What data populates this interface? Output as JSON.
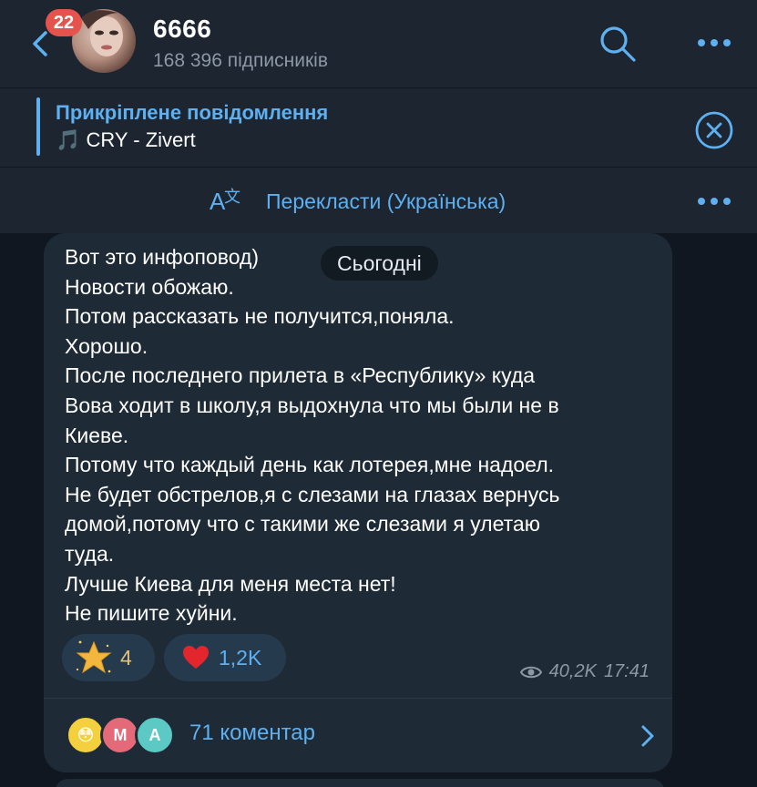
{
  "header": {
    "unread_badge": "22",
    "channel_title": "6666",
    "subscribers": "168 396 підписників",
    "icons": [
      "back-chevron-icon",
      "search-icon",
      "more-icon"
    ]
  },
  "pinned": {
    "label": "Прикріплене повідомлення",
    "text": "🎵 CRY - Zivert",
    "close_icon": "close-circle-icon"
  },
  "translate": {
    "label": "Перекласти (Українська)",
    "icon": "translate-icon"
  },
  "message": {
    "date_pill": "Сьогодні",
    "lines": [
      "Вот это инфоповод)",
      "Новости обожаю.",
      "Потом рассказать не получится,поняла.",
      "Хорошо.",
      "После последнего прилета в «Республику» куда",
      "Вова ходит в школу,я выдохнула что мы были не в",
      "Киеве.",
      "Потому что каждый день как лотерея,мне надоел.",
      "Не будет обстрелов,я с слезами на глазах вернусь",
      "домой,потому что с такими же слезами я улетаю",
      "туда.",
      "Лучше Киева для меня места нет!",
      "Не пишите хуйни."
    ],
    "reactions": [
      {
        "emoji": "⭐",
        "count": "4",
        "icon": "star-icon"
      },
      {
        "emoji": "❤️",
        "count": "1,2K",
        "icon": "heart-icon"
      }
    ],
    "views": "40,2K",
    "time": "17:41",
    "comments": {
      "avatars": [
        "😳",
        "M",
        "A"
      ],
      "label": "71 коментар"
    }
  },
  "colors": {
    "background": "#101720",
    "panel": "#1c2530",
    "bubble": "#1e2a35",
    "accent": "#5eb0f0",
    "badge": "#e5534d"
  }
}
